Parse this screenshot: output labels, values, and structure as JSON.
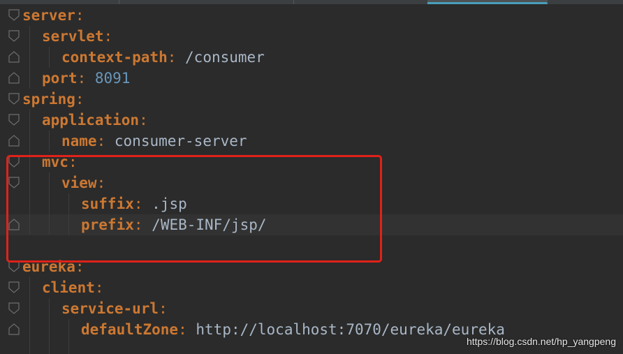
{
  "editor": {
    "file_type": "yaml",
    "lines": [
      {
        "key": "server",
        "indent": 0,
        "value": null,
        "value_type": null
      },
      {
        "key": "servlet",
        "indent": 1,
        "value": null,
        "value_type": null
      },
      {
        "key": "context-path",
        "indent": 2,
        "value": "/consumer",
        "value_type": "string"
      },
      {
        "key": "port",
        "indent": 1,
        "value": "8091",
        "value_type": "number"
      },
      {
        "key": "spring",
        "indent": 0,
        "value": null,
        "value_type": null
      },
      {
        "key": "application",
        "indent": 1,
        "value": null,
        "value_type": null
      },
      {
        "key": "name",
        "indent": 2,
        "value": "consumer-server",
        "value_type": "string"
      },
      {
        "key": "mvc",
        "indent": 1,
        "value": null,
        "value_type": null
      },
      {
        "key": "view",
        "indent": 2,
        "value": null,
        "value_type": null
      },
      {
        "key": "suffix",
        "indent": 3,
        "value": ".jsp",
        "value_type": "string"
      },
      {
        "key": "prefix",
        "indent": 3,
        "value": "/WEB-INF/jsp/",
        "value_type": "string"
      },
      {
        "key": null,
        "indent": 0,
        "value": null,
        "value_type": null
      },
      {
        "key": "eureka",
        "indent": 0,
        "value": null,
        "value_type": null
      },
      {
        "key": "client",
        "indent": 1,
        "value": null,
        "value_type": null
      },
      {
        "key": "service-url",
        "indent": 2,
        "value": null,
        "value_type": null
      },
      {
        "key": "defaultZone",
        "indent": 3,
        "value": "http://localhost:7070/eureka/eureka",
        "value_type": "string"
      }
    ]
  },
  "annotation": {
    "highlight_color": "#e0221a"
  },
  "watermark": {
    "text": "https://blog.csdn.net/hp_yangpeng"
  },
  "colors": {
    "background": "#2b2b2b",
    "key": "#cc7832",
    "string": "#a9b7c6",
    "number": "#6897bb",
    "active_tab_accent": "#4a9ebc"
  }
}
